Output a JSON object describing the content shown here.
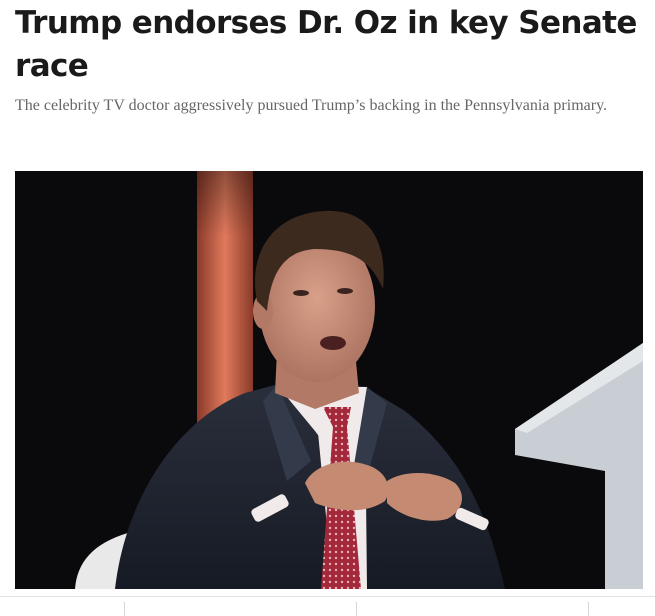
{
  "article": {
    "headline": "Trump endorses Dr. Oz in key Senate race",
    "dek": "The celebrity TV doctor aggressively pursued Trump’s backing in the Pennsylvania primary."
  },
  "colors": {
    "headline": "#1a1a1a",
    "dek": "#666666",
    "photo_background": "#0a0a0c"
  }
}
